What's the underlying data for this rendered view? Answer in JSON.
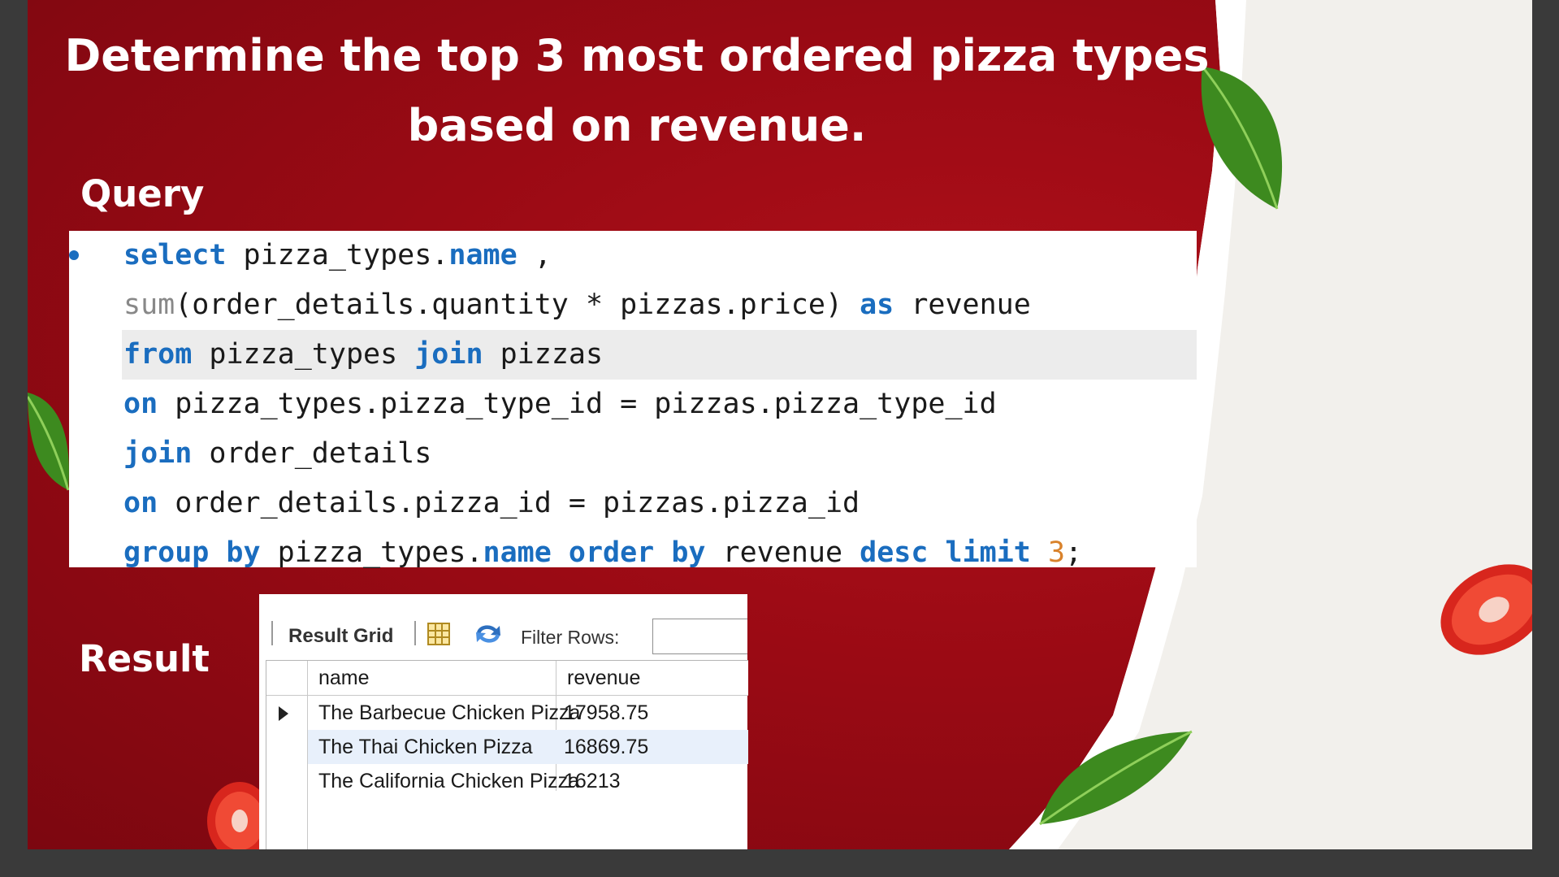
{
  "slide": {
    "title_line1": "Determine the top 3 most ordered pizza types",
    "title_line2": "based on revenue.",
    "query_label": "Query",
    "result_label": "Result"
  },
  "code": {
    "lines": [
      {
        "parts": [
          {
            "t": "select",
            "c": "kw"
          },
          {
            "t": " pizza_types.",
            "c": ""
          },
          {
            "t": "name",
            "c": "kw"
          },
          {
            "t": " ,",
            "c": ""
          }
        ]
      },
      {
        "parts": [
          {
            "t": "sum",
            "c": "fn"
          },
          {
            "t": "(order_details.quantity * pizzas.price) ",
            "c": ""
          },
          {
            "t": "as",
            "c": "kw"
          },
          {
            "t": " revenue",
            "c": ""
          }
        ]
      },
      {
        "parts": [
          {
            "t": "from",
            "c": "kw"
          },
          {
            "t": " pizza_types ",
            "c": ""
          },
          {
            "t": "join",
            "c": "kw"
          },
          {
            "t": " pizzas",
            "c": ""
          }
        ]
      },
      {
        "parts": [
          {
            "t": "on",
            "c": "kw"
          },
          {
            "t": " pizza_types.pizza_type_id = pizzas.pizza_type_id",
            "c": ""
          }
        ]
      },
      {
        "parts": [
          {
            "t": "join",
            "c": "kw"
          },
          {
            "t": " order_details",
            "c": ""
          }
        ]
      },
      {
        "parts": [
          {
            "t": "on",
            "c": "kw"
          },
          {
            "t": " order_details.pizza_id = pizzas.pizza_id",
            "c": ""
          }
        ]
      },
      {
        "parts": [
          {
            "t": "group by",
            "c": "kw"
          },
          {
            "t": " pizza_types.",
            "c": ""
          },
          {
            "t": "name",
            "c": "kw"
          },
          {
            "t": " ",
            "c": ""
          },
          {
            "t": "order by",
            "c": "kw"
          },
          {
            "t": " revenue ",
            "c": ""
          },
          {
            "t": "desc",
            "c": "kw"
          },
          {
            "t": " ",
            "c": ""
          },
          {
            "t": "limit",
            "c": "kw"
          },
          {
            "t": " ",
            "c": ""
          },
          {
            "t": "3",
            "c": "num"
          },
          {
            "t": ";",
            "c": ""
          }
        ]
      }
    ]
  },
  "result": {
    "toolbar": {
      "result_grid_label": "Result Grid",
      "filter_label": "Filter Rows:",
      "filter_value": ""
    },
    "columns": [
      "name",
      "revenue"
    ],
    "rows": [
      {
        "name": "The Barbecue Chicken Pizza",
        "revenue": "17958.75"
      },
      {
        "name": "The Thai Chicken Pizza",
        "revenue": "16869.75"
      },
      {
        "name": "The California Chicken Pizza",
        "revenue": "16213"
      }
    ]
  },
  "colors": {
    "background_red": "#9a0a14",
    "keyword_blue": "#1a6dbf",
    "number_orange": "#d9822b"
  }
}
